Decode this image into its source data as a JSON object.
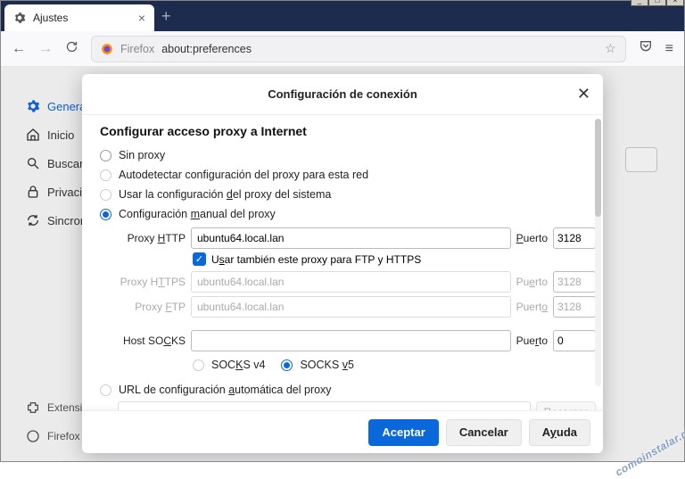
{
  "tab": {
    "title": "Ajustes"
  },
  "addressbar": {
    "prefix": "Firefox",
    "url": "about:preferences"
  },
  "sidebar": {
    "items": [
      {
        "label": "General"
      },
      {
        "label": "Inicio"
      },
      {
        "label": "Buscar"
      },
      {
        "label": "Privacidad"
      },
      {
        "label": "Sincronización"
      }
    ],
    "bottom": [
      {
        "label": "Extensiones"
      },
      {
        "label": "Firefox Account"
      }
    ]
  },
  "modal": {
    "title": "Configuración de conexión",
    "section_title": "Configurar acceso proxy a Internet",
    "options": {
      "no_proxy": "Sin proxy",
      "auto_detect": "Autodetectar configuración del proxy para esta red",
      "system_proxy": "Usar la configuración del proxy del sistema",
      "manual_proxy": "Configuración manual del proxy",
      "auto_url": "URL de configuración automática del proxy"
    },
    "labels": {
      "proxy_http": "Proxy HTTP",
      "proxy_https": "Proxy HTTPS",
      "proxy_ftp": "Proxy FTP",
      "host_socks": "Host SOCKS",
      "port": "Puerto",
      "use_for_all": "Usar también este proxy para FTP y HTTPS",
      "socks4": "SOCKS v4",
      "socks5": "SOCKS v5",
      "reload": "Recargar"
    },
    "values": {
      "http_host": "ubuntu64.local.lan",
      "http_port": "3128",
      "https_host": "ubuntu64.local.lan",
      "https_port": "3128",
      "ftp_host": "ubuntu64.local.lan",
      "ftp_port": "3128",
      "socks_host": "",
      "socks_port": "0",
      "auto_url_value": ""
    },
    "buttons": {
      "accept": "Aceptar",
      "cancel": "Cancelar",
      "help": "Ayuda"
    }
  },
  "watermark": "comoinstalar.me"
}
